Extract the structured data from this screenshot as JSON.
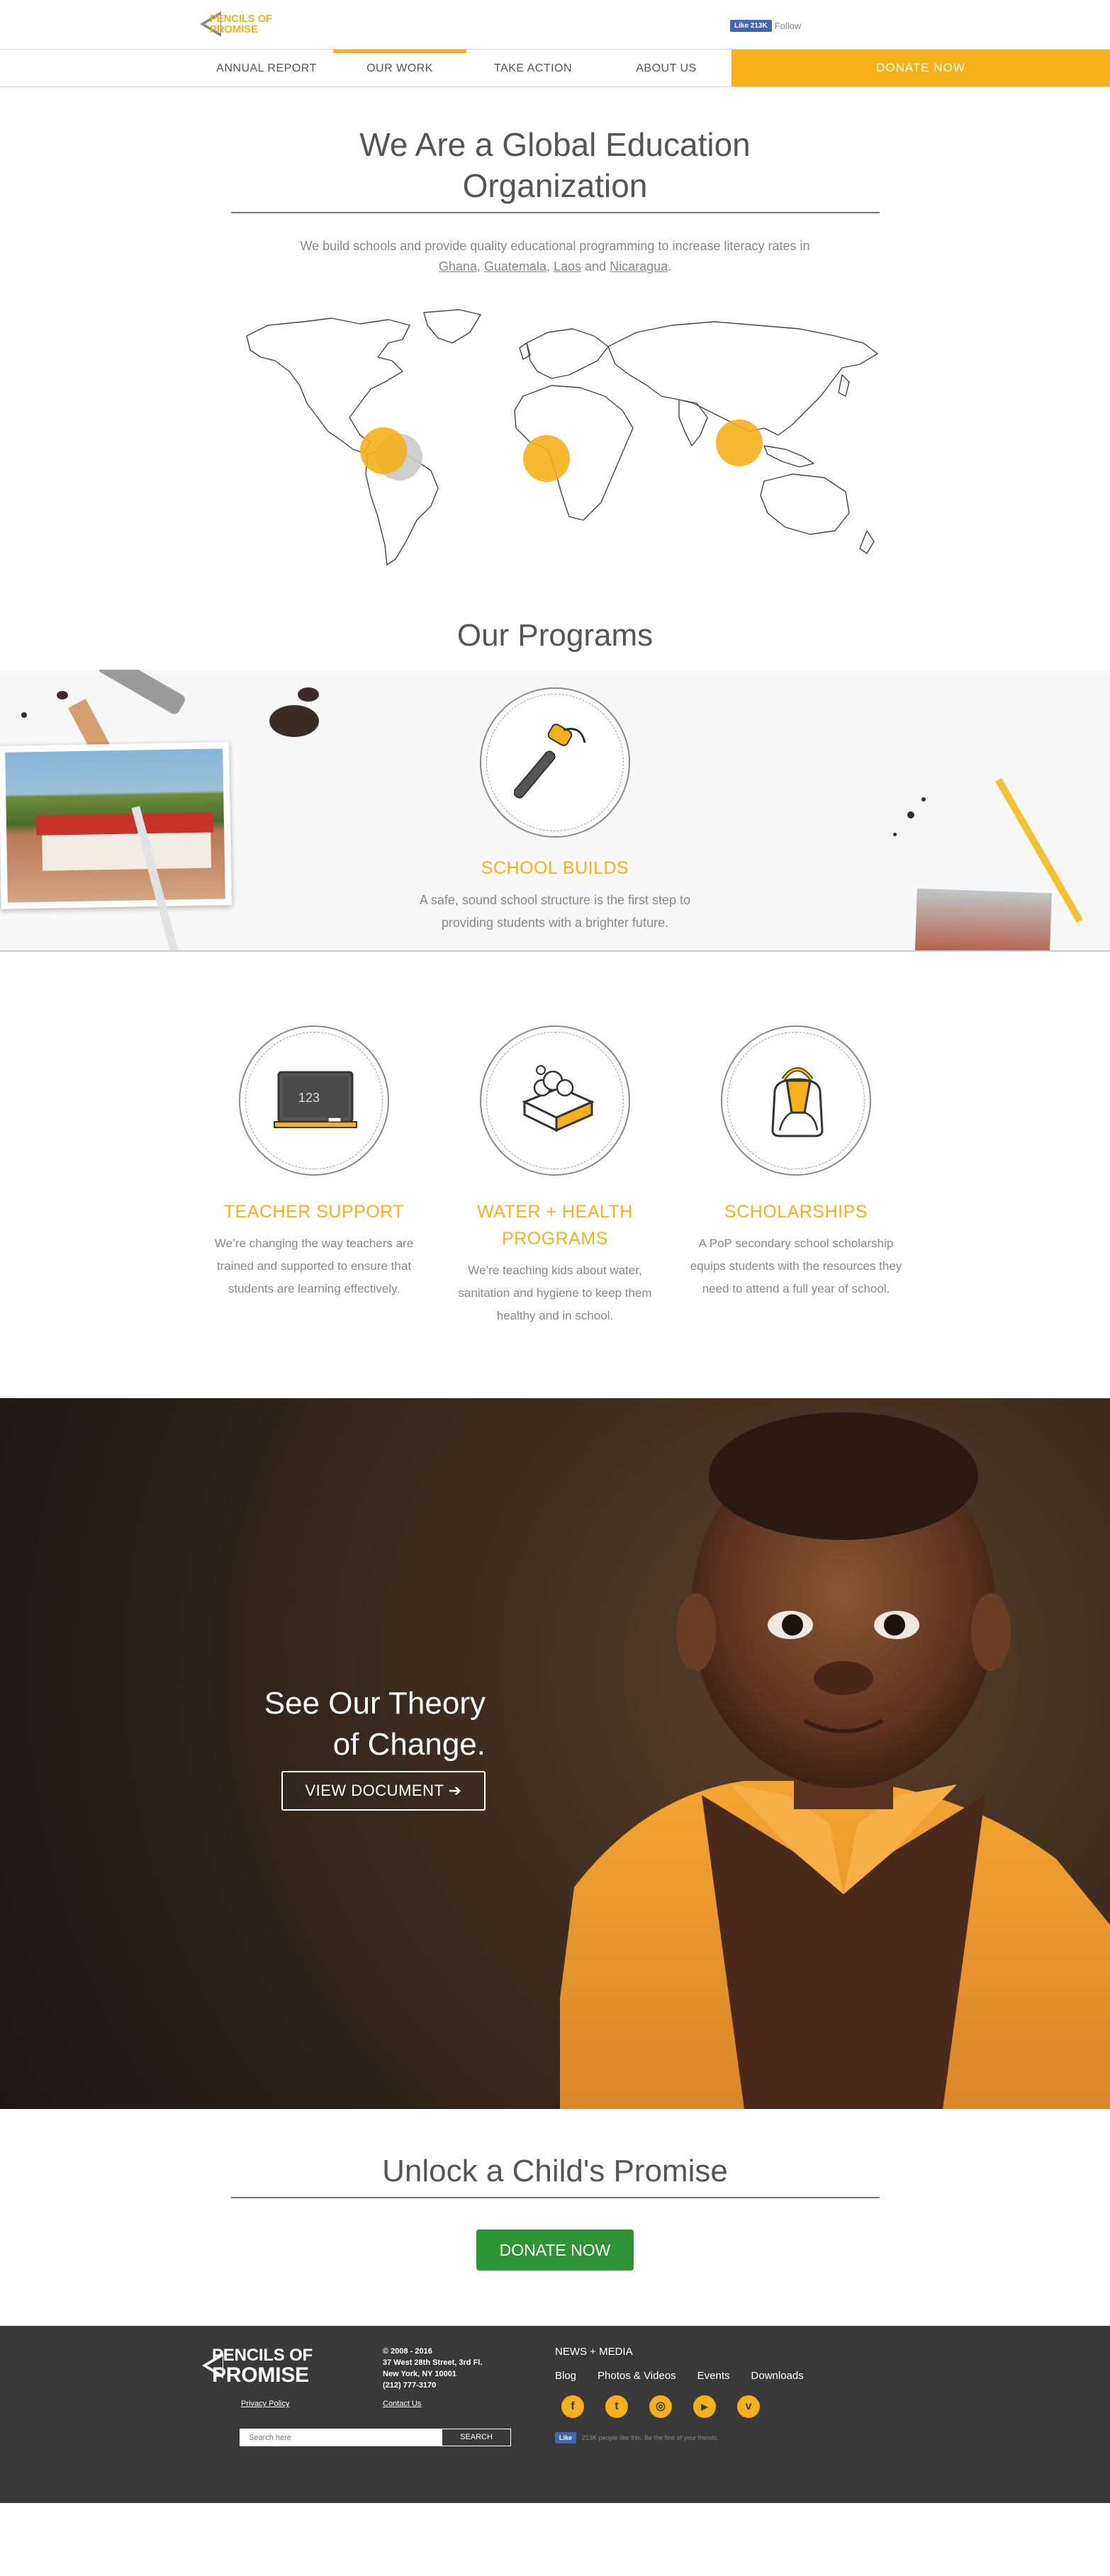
{
  "header": {
    "logo_top": "PENCILS OF",
    "logo_bottom": "PROMISE",
    "fb_like": "Like 213K",
    "fb_follow": "Follow"
  },
  "nav": {
    "items": [
      "ANNUAL REPORT",
      "OUR WORK",
      "TAKE ACTION",
      "ABOUT US"
    ],
    "active": "OUR WORK",
    "donate": "DONATE NOW"
  },
  "intro": {
    "title_line1": "We Are a Global Education",
    "title_line2": "Organization",
    "text": "We build schools and provide quality educational programming to increase literacy rates in",
    "countries": [
      "Ghana",
      "Guatemala",
      "Laos",
      "Nicaragua"
    ],
    "sep1": ", ",
    "sep2": ", ",
    "sep3": " and ",
    "end": "."
  },
  "programs": {
    "title": "Our Programs",
    "school": {
      "name": "SCHOOL BUILDS",
      "desc_line1": "A safe, sound school structure is the first step to",
      "desc_line2": "providing students with a brighter future."
    },
    "items": [
      {
        "name": "TEACHER SUPPORT",
        "desc": "We’re changing the way teachers are trained and supported to ensure that students are learning effectively.",
        "icon": "chalkboard-icon",
        "board_text": "123"
      },
      {
        "name": "WATER + HEALTH PROGRAMS",
        "desc": "We’re teaching kids about water, sanitation and hygiene to keep them healthy and in school.",
        "icon": "soap-icon"
      },
      {
        "name": "SCHOLARSHIPS",
        "desc": "A PoP secondary school scholarship equips students with the resources they need to attend a full year of school.",
        "icon": "backpack-icon"
      }
    ]
  },
  "hero": {
    "line1": "See Our Theory",
    "line2": "of Change.",
    "button": "VIEW DOCUMENT ➔"
  },
  "cta": {
    "title": "Unlock a Child's Promise",
    "button": "DONATE NOW"
  },
  "footer": {
    "logo_top": "PENCILS OF",
    "logo_bottom": "PROMISE",
    "copyright": "© 2008 - 2016",
    "address1": "37 West 28th Street, 3rd Fl.",
    "address2": "New York, NY 10001",
    "phone": "(212) 777-3170",
    "privacy": "Privacy Policy",
    "contact": "Contact Us",
    "search_placeholder": "Search here",
    "search_button": "SEARCH",
    "news_title": "NEWS + MEDIA",
    "menu": [
      "Blog",
      "Photos & Videos",
      "Events",
      "Downloads"
    ],
    "social": [
      {
        "icon": "facebook-icon",
        "glyph": "f"
      },
      {
        "icon": "twitter-icon",
        "glyph": "t"
      },
      {
        "icon": "instagram-icon",
        "glyph": "◎"
      },
      {
        "icon": "youtube-icon",
        "glyph": "▶"
      },
      {
        "icon": "vimeo-icon",
        "glyph": "v"
      }
    ],
    "fb_like": "Like",
    "fb_text": "213K people like this. Be the first of your friends."
  },
  "colors": {
    "accent": "#f5b01a",
    "donate_green": "#2e9435",
    "footer_bg": "#393939"
  }
}
